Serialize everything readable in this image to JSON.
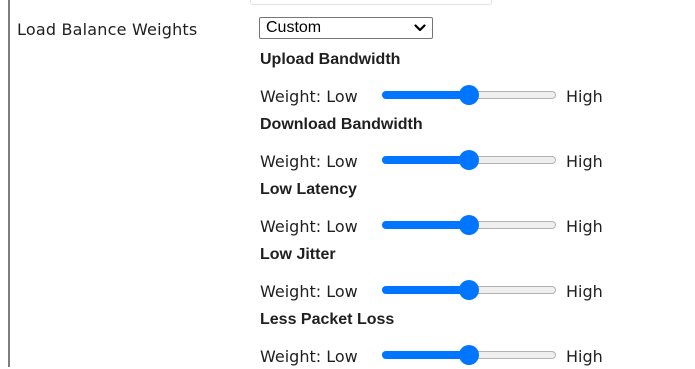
{
  "field": {
    "label": "Load Balance Weights",
    "selected_option": "Custom"
  },
  "weights": [
    {
      "heading": "Upload Bandwidth",
      "prefix": "Weight: Low",
      "suffix": "High",
      "value_fraction": 0.5
    },
    {
      "heading": "Download Bandwidth",
      "prefix": "Weight: Low",
      "suffix": "High",
      "value_fraction": 0.5
    },
    {
      "heading": "Low Latency",
      "prefix": "Weight: Low",
      "suffix": "High",
      "value_fraction": 0.5
    },
    {
      "heading": "Low Jitter",
      "prefix": "Weight: Low",
      "suffix": "High",
      "value_fraction": 0.5
    },
    {
      "heading": "Less Packet Loss",
      "prefix": "Weight: Low",
      "suffix": "High",
      "value_fraction": 0.5
    }
  ],
  "colors": {
    "slider_accent": "#0075ff",
    "track": "#efefef",
    "left_rule": "#7d7d7d"
  },
  "icons": {
    "select_toggle": "chevron-down-icon"
  }
}
